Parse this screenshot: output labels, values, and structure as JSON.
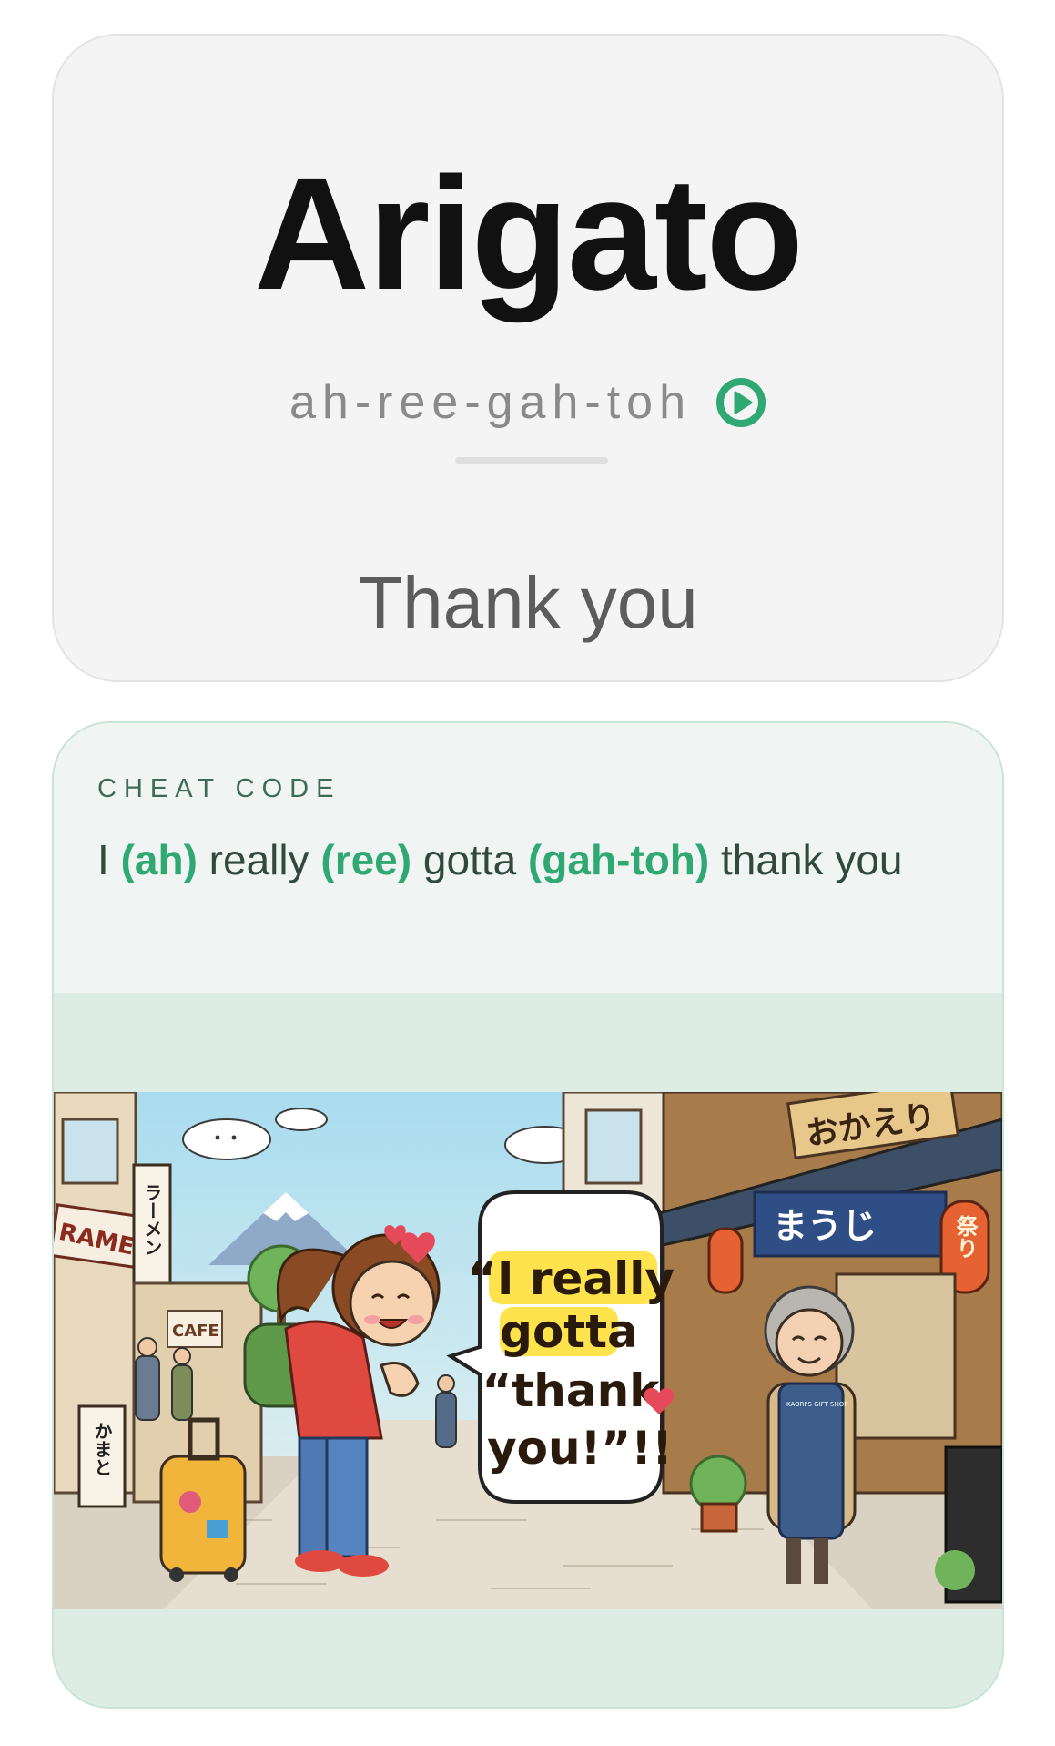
{
  "word": {
    "title": "Arigato",
    "pronunciation": "ah-ree-gah-toh",
    "play_icon": "play-circle-icon",
    "translation": "Thank you"
  },
  "cheat_code": {
    "label": "CHEAT CODE",
    "parts": [
      {
        "text": "I "
      },
      {
        "text": "(ah)",
        "highlight": true
      },
      {
        "text": " really "
      },
      {
        "text": "(ree)",
        "highlight": true
      },
      {
        "text": " gotta "
      },
      {
        "text": "(gah-toh)",
        "highlight": true
      },
      {
        "text": " thank you"
      }
    ]
  },
  "illustration": {
    "speech_bubble": [
      "“I really",
      "gotta",
      "“thank",
      "you!”!!"
    ],
    "signs": {
      "ramen": "RAMEN",
      "ramen_vertical": "ラーメン",
      "cafe": "CAFE",
      "kamato": "かまと",
      "okaeri": "おかえり",
      "banner": "まうじ",
      "lantern": "祭り",
      "apron": "KAORI'S GIFT SHOP"
    }
  },
  "colors": {
    "accent_green": "#2fa874",
    "title": "#111111",
    "pron": "#8a8a8a",
    "translation": "#5c5c5c",
    "card_bg": "#f4f4f4",
    "cheat_bg": "#ddede5",
    "cheat_head_bg": "#f0f4f2"
  }
}
